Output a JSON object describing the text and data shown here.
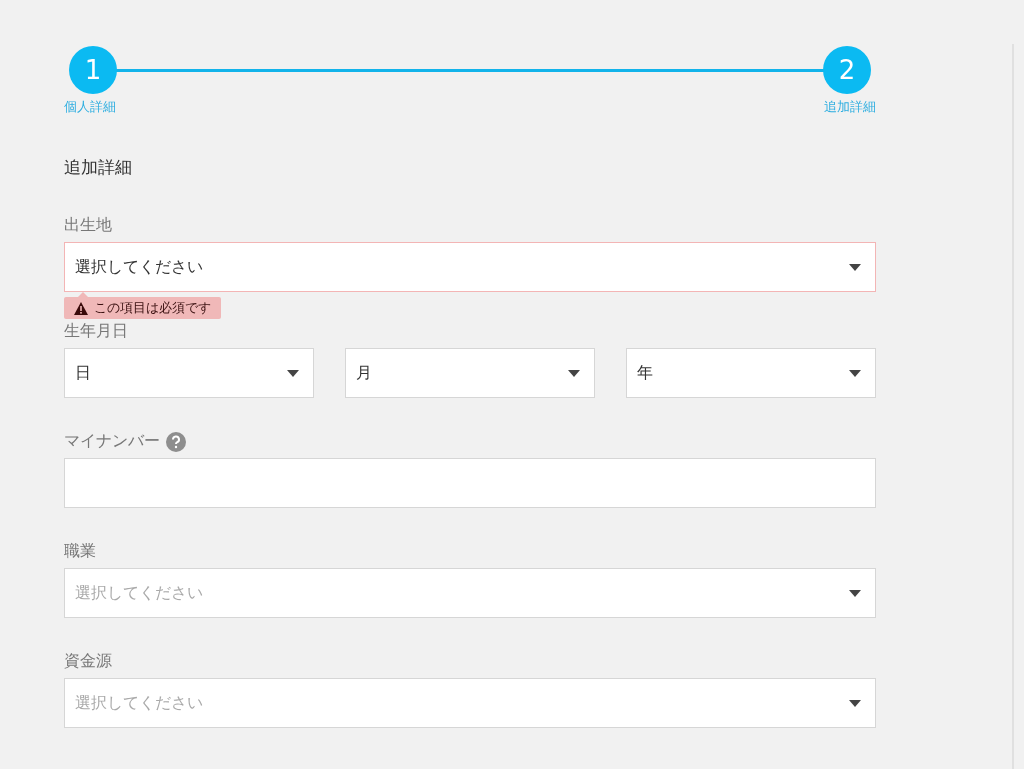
{
  "steps": [
    {
      "number": "1",
      "label": "個人詳細"
    },
    {
      "number": "2",
      "label": "追加詳細"
    }
  ],
  "section_title": "追加詳細",
  "fields": [
    {
      "kind": "select",
      "label": "出生地",
      "value": "選択してください",
      "error": "この項目は必須です"
    },
    {
      "kind": "date",
      "label": "生年月日",
      "parts": [
        "日",
        "月",
        "年"
      ]
    },
    {
      "kind": "input",
      "label": "マイナンバー",
      "help": true
    },
    {
      "kind": "select",
      "label": "職業",
      "placeholder": "選択してください"
    },
    {
      "kind": "select",
      "label": "資金源",
      "placeholder": "選択してください"
    }
  ]
}
